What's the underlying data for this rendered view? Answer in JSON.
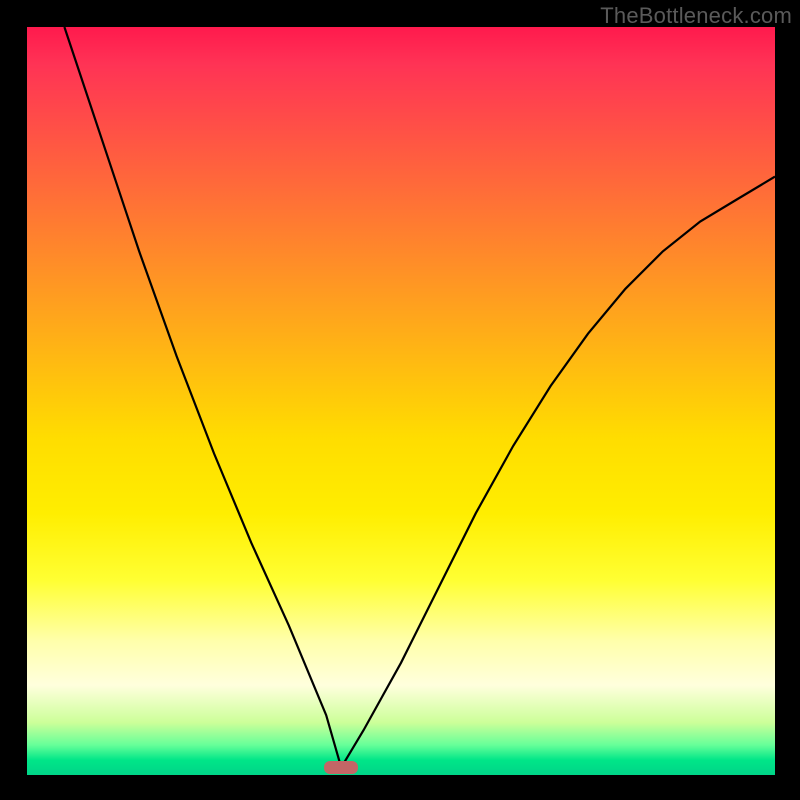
{
  "watermark": "TheBottleneck.com",
  "chart_data": {
    "type": "line",
    "title": "",
    "xlabel": "",
    "ylabel": "",
    "x_range": [
      0,
      100
    ],
    "y_range": [
      0,
      100
    ],
    "minimum_x": 42,
    "series": [
      {
        "name": "bottleneck-curve",
        "description": "V-shaped bottleneck curve with minimum near x=42",
        "x": [
          5,
          10,
          15,
          20,
          25,
          30,
          35,
          40,
          42,
          45,
          50,
          55,
          60,
          65,
          70,
          75,
          80,
          85,
          90,
          95,
          100
        ],
        "y": [
          100,
          85,
          70,
          56,
          43,
          31,
          20,
          8,
          1,
          6,
          15,
          25,
          35,
          44,
          52,
          59,
          65,
          70,
          74,
          77,
          80
        ]
      }
    ],
    "marker": {
      "x": 42,
      "y": 1,
      "color": "#c46666"
    },
    "gradient_colors": {
      "top": "#ff1a4d",
      "mid": "#ffee00",
      "bottom": "#00d488"
    }
  }
}
